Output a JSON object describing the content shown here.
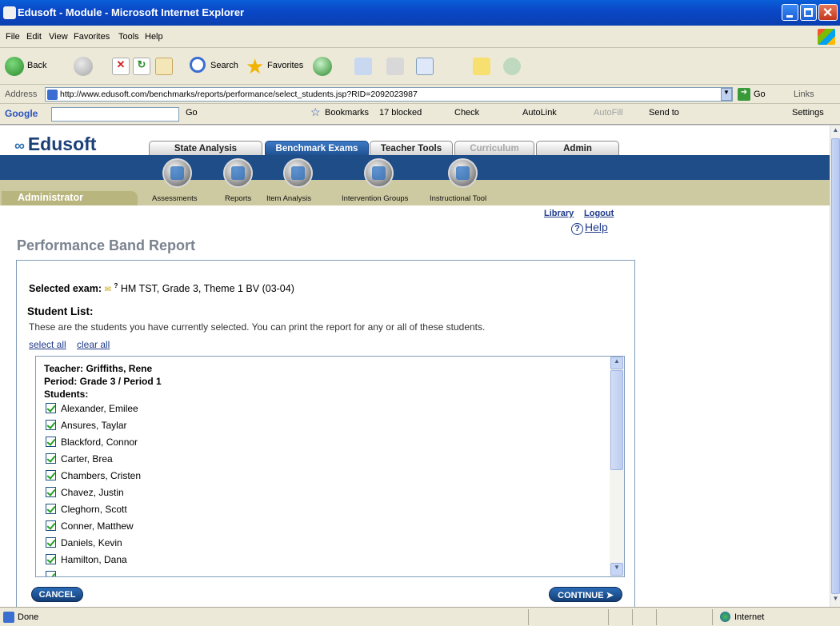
{
  "window": {
    "title": "Edusoft - Module - Microsoft Internet Explorer"
  },
  "menu": [
    "File",
    "Edit",
    "View",
    "Favorites",
    "Tools",
    "Help"
  ],
  "toolbar": {
    "back": "Back",
    "search": "Search",
    "favorites": "Favorites"
  },
  "address": {
    "label": "Address",
    "url": "http://www.edusoft.com/benchmarks/reports/performance/select_students.jsp?RID=2092023987",
    "go": "Go",
    "links": "Links"
  },
  "googlebar": {
    "label": "Google",
    "go": "Go",
    "bookmarks": "Bookmarks",
    "blocked": "17 blocked",
    "check": "Check",
    "autolink": "AutoLink",
    "autofill": "AutoFill",
    "sendto": "Send to",
    "settings": "Settings"
  },
  "app": {
    "logo": "Edusoft",
    "tabs": [
      "State Analysis",
      "Benchmark Exams",
      "Teacher Tools",
      "Curriculum",
      "Admin"
    ],
    "nav": [
      "Assessments",
      "Reports",
      "Item Analysis",
      "Intervention Groups",
      "Instructional Tool"
    ],
    "role": "Administrator",
    "library": "Library",
    "logout": "Logout",
    "help": "Help"
  },
  "report": {
    "title": "Performance Band Report",
    "selected_exam_label": "Selected exam:",
    "selected_exam": "HM TST, Grade 3, Theme 1 BV (03-04)",
    "student_list_label": "Student List:",
    "instructions": "These are the students you have currently selected. You can print the report for any or all of these students.",
    "select_all": "select all",
    "clear_all": "clear all",
    "teacher": "Teacher: Griffiths, Rene",
    "period": "Period: Grade 3 / Period 1",
    "students_label": "Students:",
    "students": [
      "Alexander, Emilee",
      "Ansures, Taylar",
      "Blackford, Connor",
      "Carter, Brea",
      "Chambers, Cristen",
      "Chavez, Justin",
      "Cleghorn, Scott",
      "Conner, Matthew",
      "Daniels, Kevin",
      "Hamilton, Dana"
    ],
    "cancel": "CANCEL",
    "continue": "CONTINUE ➤"
  },
  "status": {
    "text": "Done",
    "zone": "Internet"
  }
}
